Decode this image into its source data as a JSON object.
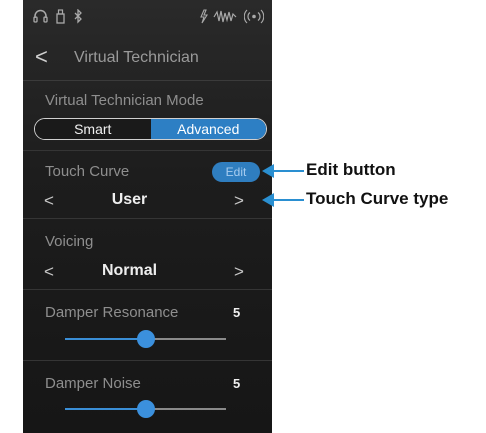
{
  "status": {
    "icons": [
      "headphones-icon",
      "usb-icon",
      "bluetooth-icon",
      "mic-icon",
      "waveform-icon",
      "wireless-icon"
    ]
  },
  "header": {
    "back_glyph": "<",
    "title": "Virtual Technician"
  },
  "mode": {
    "label": "Virtual Technician Mode",
    "options": [
      "Smart",
      "Advanced"
    ],
    "selected": "Advanced"
  },
  "touch_curve": {
    "label": "Touch Curve",
    "edit_label": "Edit",
    "value": "User",
    "prev_glyph": "<",
    "next_glyph": ">"
  },
  "voicing": {
    "label": "Voicing",
    "value": "Normal",
    "prev_glyph": "<",
    "next_glyph": ">"
  },
  "damper_resonance": {
    "label": "Damper Resonance",
    "value": "5",
    "level_fraction": 0.5
  },
  "damper_noise": {
    "label": "Damper Noise",
    "value": "5",
    "level_fraction": 0.5
  },
  "callouts": {
    "edit": "Edit button",
    "touch_curve_type": "Touch Curve type"
  },
  "colors": {
    "accent": "#2d7fc4",
    "callout": "#2a8fd1"
  }
}
